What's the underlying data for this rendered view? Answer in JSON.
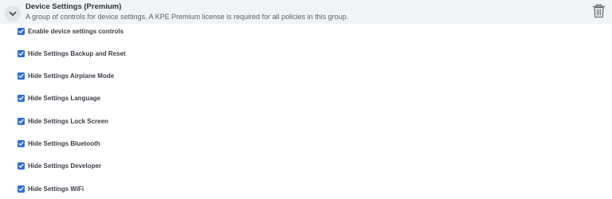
{
  "group": {
    "title": "Device Settings (Premium)",
    "description": "A group of controls for device settings. A KPE Premium license is required for all policies in this group.",
    "expanded": true,
    "collapse_icon": "chevron-down-icon",
    "delete_icon": "trash-icon"
  },
  "colors": {
    "header_bg": "#f2f3f5",
    "checkbox": "#2f6fd6"
  },
  "settings": [
    {
      "label": "Enable device settings controls",
      "checked": true
    },
    {
      "label": "Hide Settings Backup and Reset",
      "checked": true
    },
    {
      "label": "Hide Settings Airplane Mode",
      "checked": true
    },
    {
      "label": "Hide Settings Language",
      "checked": true
    },
    {
      "label": "Hide Settings Lock Screen",
      "checked": true
    },
    {
      "label": "Hide Settings Bluetooth",
      "checked": true
    },
    {
      "label": "Hide Settings Developer",
      "checked": true
    },
    {
      "label": "Hide Settings WiFi",
      "checked": true
    }
  ]
}
